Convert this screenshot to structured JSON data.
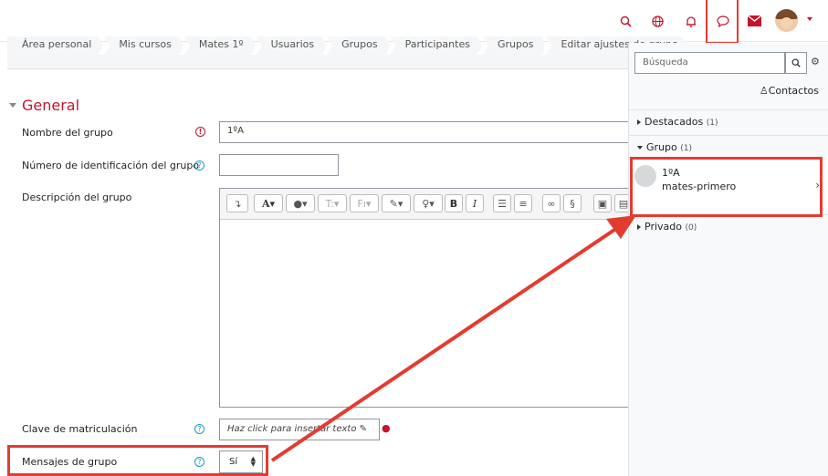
{
  "breadcrumb": [
    "Área personal",
    "Mis cursos",
    "Mates 1º",
    "Usuarios",
    "Grupos",
    "Participantes",
    "Grupos",
    "Editar ajustes de grupo"
  ],
  "section_title": "General",
  "form": {
    "group_name_label": "Nombre del grupo",
    "group_name_value": "1ºA",
    "idnumber_label": "Número de identificación del grupo",
    "description_label": "Descripción del grupo",
    "enrolment_key_label": "Clave de matriculación",
    "enrolment_key_placeholder": "Haz click para insertar texto",
    "group_messages_label": "Mensajes de grupo",
    "group_messages_value": "Sí"
  },
  "drawer": {
    "search_placeholder": "Búsqueda",
    "contacts_label": "Contactos",
    "categories": [
      {
        "label": "Destacados",
        "count": "(1)"
      },
      {
        "label": "Grupo",
        "count": "(1)"
      },
      {
        "label": "Privado",
        "count": "(0)"
      }
    ],
    "conversation": {
      "name": "1ºA",
      "subtitle": "mates-primero"
    }
  },
  "colors": {
    "accent": "#c4142a",
    "highlight": "#e23c30",
    "help": "#1aa0b8"
  }
}
